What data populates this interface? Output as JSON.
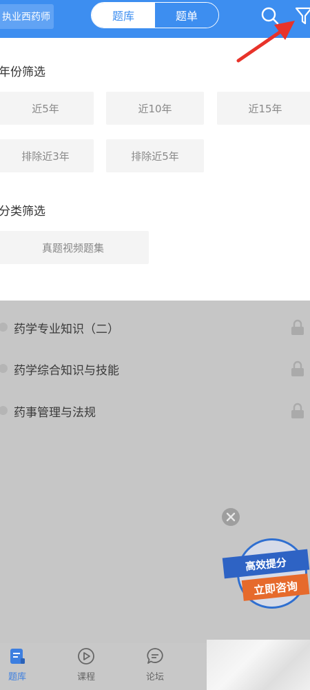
{
  "header": {
    "exam_label": "执业西药师",
    "tabs": [
      {
        "label": "题库",
        "active": true
      },
      {
        "label": "题单",
        "active": false
      }
    ],
    "icons": [
      "search-icon",
      "filter-icon"
    ],
    "accent_color": "#3d8ef0"
  },
  "filters": {
    "year": {
      "title": "年份筛选",
      "options": [
        "近5年",
        "近10年",
        "近15年",
        "排除近3年",
        "排除近5年"
      ]
    },
    "category": {
      "title": "分类筛选",
      "options": [
        "真题视频题集"
      ]
    }
  },
  "subjects": [
    {
      "label": "药学专业知识（二）",
      "locked": true
    },
    {
      "label": "药学综合知识与技能",
      "locked": true
    },
    {
      "label": "药事管理与法规",
      "locked": true
    }
  ],
  "promo": {
    "line1": "高效提分",
    "line2": "立即咨询"
  },
  "bottom_nav": [
    {
      "label": "题库",
      "icon": "question-bank-icon",
      "active": true
    },
    {
      "label": "课程",
      "icon": "play-circle-icon",
      "active": false
    },
    {
      "label": "论坛",
      "icon": "chat-bubble-icon",
      "active": false
    }
  ]
}
